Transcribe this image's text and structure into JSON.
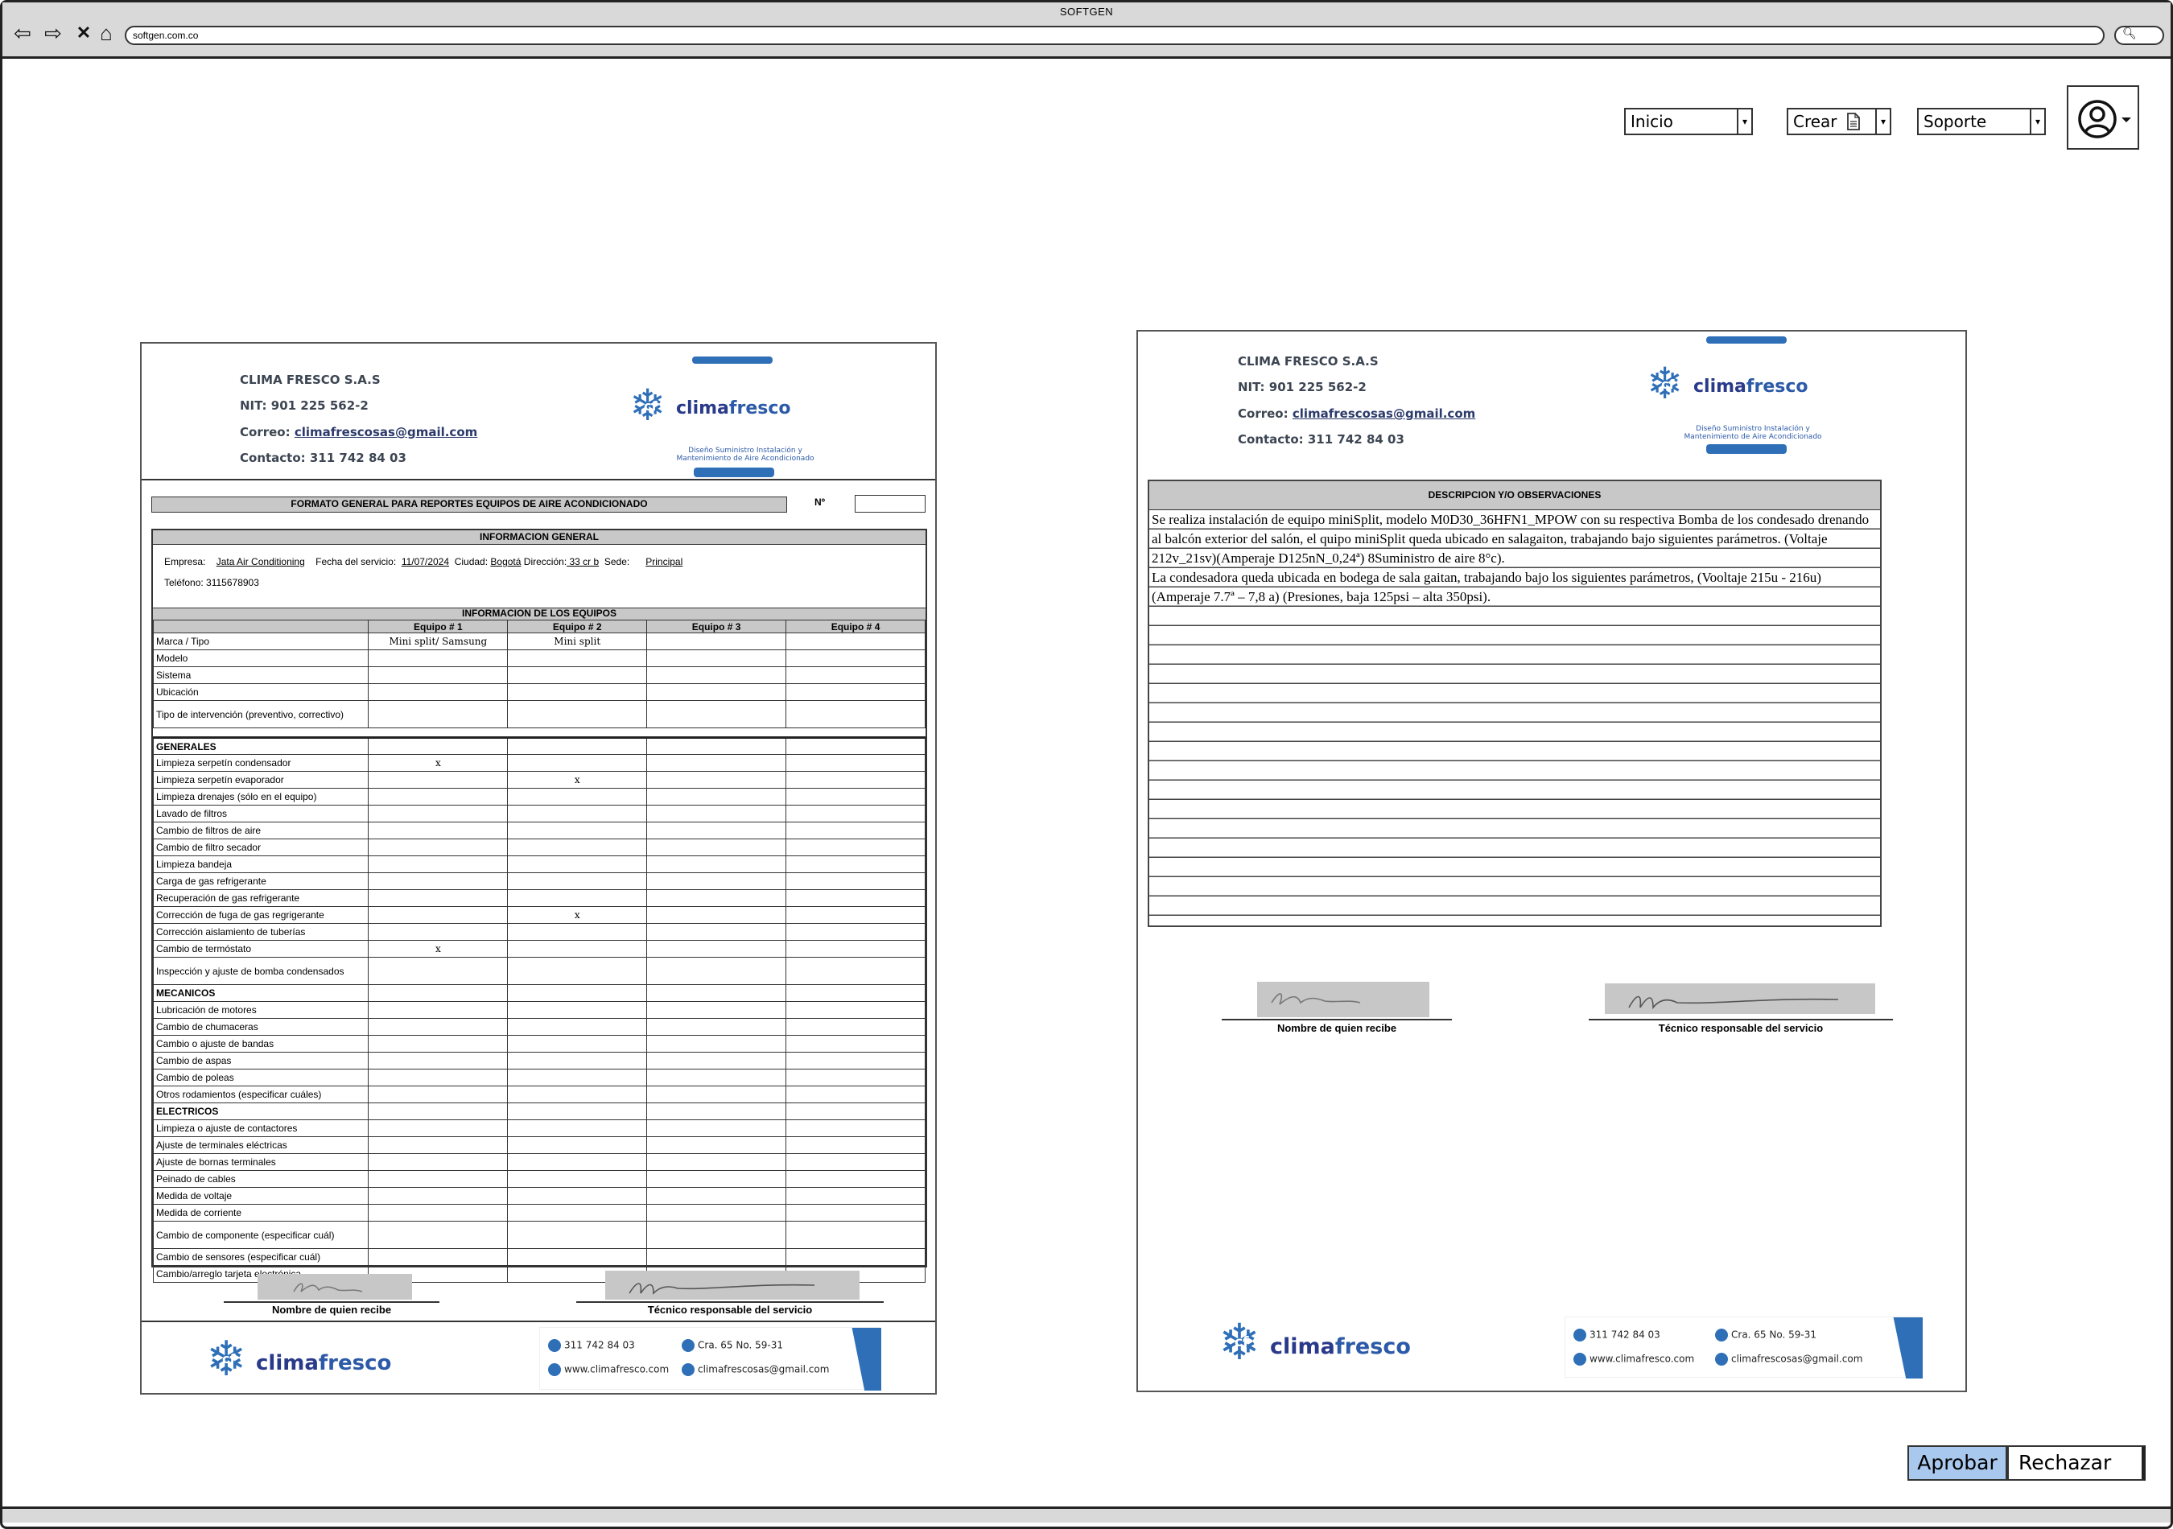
{
  "window": {
    "title": "SOFTGEN",
    "url": "softgen.com.co"
  },
  "nav": {
    "inicio": "Inicio",
    "crear": "Crear",
    "soporte": "Soporte"
  },
  "actions": {
    "approve": "Aprobar",
    "reject": "Rechazar"
  },
  "company": {
    "name": "CLIMA FRESCO S.A.S",
    "nit": "NIT: 901 225 562-2",
    "correo_label": "Correo:",
    "correo": "climafrescosas@gmail.com",
    "contacto": "Contacto: 311 742 84 03",
    "logo_cf": "cf",
    "logo_clima": "clima",
    "logo_fresco": "fresco",
    "tagline1": "Diseño Suministro Instalación y",
    "tagline2": "Mantenimiento de Aire Acondicionado"
  },
  "report": {
    "title": "FORMATO GENERAL PARA REPORTES EQUIPOS DE AIRE ACONDICIONADO",
    "number_label": "Nº",
    "info_title": "INFORMACION GENERAL",
    "empresa_label": "Empresa:",
    "empresa": "Jata Air Conditioning",
    "fecha_label": "Fecha del servicio:",
    "fecha": "11/07/2024",
    "ciudad_label": "Ciudad:",
    "ciudad": "Bogotá",
    "direccion_label": "Dirección:",
    "direccion": " 33 cr b",
    "sede_label": "Sede:",
    "sede": "Principal",
    "telefono": "Teléfono: 3115678903",
    "equipos_title": "INFORMACION DE LOS EQUIPOS",
    "columns": [
      "Equipo # 1",
      "Equipo # 2",
      "Equipo # 3",
      "Equipo # 4"
    ],
    "equip_rows": [
      {
        "label": "Marca / Tipo",
        "values": [
          "Mini split/ Samsung",
          "Mini split",
          "",
          ""
        ]
      },
      {
        "label": "Modelo",
        "values": [
          "",
          "",
          "",
          ""
        ]
      },
      {
        "label": "Sistema",
        "values": [
          "",
          "",
          "",
          ""
        ]
      },
      {
        "label": "Ubicación",
        "values": [
          "",
          "",
          "",
          ""
        ]
      },
      {
        "label": "Tipo de intervención (preventivo, correctivo)",
        "values": [
          "",
          "",
          "",
          ""
        ]
      }
    ],
    "generales_title": "GENERALES",
    "generales": [
      {
        "label": "Limpieza serpetín condensador",
        "values": [
          "x",
          "",
          "",
          ""
        ]
      },
      {
        "label": "Limpieza serpetín evaporador",
        "values": [
          "",
          "x",
          "",
          ""
        ]
      },
      {
        "label": "Limpieza drenajes (sólo en el equipo)",
        "values": [
          "",
          "",
          "",
          ""
        ]
      },
      {
        "label": "Lavado de filtros",
        "values": [
          "",
          "",
          "",
          ""
        ]
      },
      {
        "label": "Cambio de filtros de aire",
        "values": [
          "",
          "",
          "",
          ""
        ]
      },
      {
        "label": "Cambio de filtro secador",
        "values": [
          "",
          "",
          "",
          ""
        ]
      },
      {
        "label": "Limpieza bandeja",
        "values": [
          "",
          "",
          "",
          ""
        ]
      },
      {
        "label": "Carga de gas refrigerante",
        "values": [
          "",
          "",
          "",
          ""
        ]
      },
      {
        "label": "Recuperación de gas refrigerante",
        "values": [
          "",
          "",
          "",
          ""
        ]
      },
      {
        "label": "Corrección de fuga de gas regrigerante",
        "values": [
          "",
          "x",
          "",
          ""
        ]
      },
      {
        "label": "Corrección aislamiento de tuberías",
        "values": [
          "",
          "",
          "",
          ""
        ]
      },
      {
        "label": "Cambio de termóstato",
        "values": [
          "x",
          "",
          "",
          ""
        ]
      },
      {
        "label": "Inspección y ajuste de bomba condensados",
        "values": [
          "",
          "",
          "",
          ""
        ]
      }
    ],
    "mecanicos_title": "MECANICOS",
    "mecanicos": [
      {
        "label": "Lubricación de motores",
        "values": [
          "",
          "",
          "",
          ""
        ]
      },
      {
        "label": "Cambio de chumaceras",
        "values": [
          "",
          "",
          "",
          ""
        ]
      },
      {
        "label": "Cambio o ajuste de bandas",
        "values": [
          "",
          "",
          "",
          ""
        ]
      },
      {
        "label": "Cambio de aspas",
        "values": [
          "",
          "",
          "",
          ""
        ]
      },
      {
        "label": "Cambio de poleas",
        "values": [
          "",
          "",
          "",
          ""
        ]
      },
      {
        "label": "Otros rodamientos (especificar cuáles)",
        "values": [
          "",
          "",
          "",
          ""
        ]
      }
    ],
    "electricos_title": "ELECTRICOS",
    "electricos": [
      {
        "label": "Limpieza o ajuste de contactores",
        "values": [
          "",
          "",
          "",
          ""
        ]
      },
      {
        "label": "Ajuste de terminales eléctricas",
        "values": [
          "",
          "",
          "",
          ""
        ]
      },
      {
        "label": "Ajuste de bornas terminales",
        "values": [
          "",
          "",
          "",
          ""
        ]
      },
      {
        "label": "Peinado de cables",
        "values": [
          "",
          "",
          "",
          ""
        ]
      },
      {
        "label": "Medida de voltaje",
        "values": [
          "",
          "",
          "",
          ""
        ]
      },
      {
        "label": "Medida de corriente",
        "values": [
          "",
          "",
          "",
          ""
        ]
      },
      {
        "label": "Cambio de componente (especificar cuál)",
        "values": [
          "",
          "",
          "",
          ""
        ]
      },
      {
        "label": "Cambio de sensores (especificar cuál)",
        "values": [
          "",
          "",
          "",
          ""
        ]
      },
      {
        "label": "Cambio/arreglo tarjeta electrónica",
        "values": [
          "",
          "",
          "",
          ""
        ]
      }
    ],
    "sig_receiver": "Nombre de quien recibe",
    "sig_tech": "Técnico responsable del servicio"
  },
  "observations": {
    "title": "DESCRIPCION Y/O OBSERVACIONES",
    "paragraph1": "Se realiza instalación de equipo miniSplit, modelo M0D30_36HFN1_MPOW con su respectiva Bomba de los condesado drenando al balcón exterior del salón, el quipo miniSplit queda ubicado en salagaiton, trabajando bajo siguientes parámetros. (Voltaje 212v_21sv)(Amperaje D125nN_0,24ª) 8Suministro de aire 8°c).",
    "paragraph2": "La condesadora queda ubicada en bodega de sala gaitan, trabajando bajo los siguientes parámetros, (Vooltaje 215u - 216u) (Amperaje 7.7ª – 7,8 a) (Presiones, baja 125psi – alta 350psi)."
  },
  "footer": {
    "phone": "311 742 84 03",
    "address": "Cra. 65 No. 59-31",
    "web": "www.climafresco.com",
    "email": "climafrescosas@gmail.com"
  },
  "colors": {
    "accent": "#2e6fb7",
    "approve_bg": "#a9c8ee",
    "header_gray": "#c8c8c8"
  }
}
